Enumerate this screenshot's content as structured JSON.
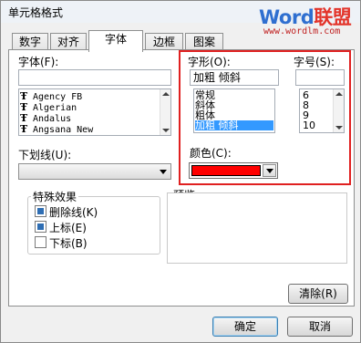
{
  "window": {
    "title": "单元格格式",
    "watermark": {
      "brand_left": "Word",
      "brand_right": "联盟",
      "url": "www.wordlm.com"
    }
  },
  "tabs": [
    {
      "label": "数字",
      "active": false
    },
    {
      "label": "对齐",
      "active": false
    },
    {
      "label": "字体",
      "active": true
    },
    {
      "label": "边框",
      "active": false
    },
    {
      "label": "图案",
      "active": false
    }
  ],
  "font": {
    "label": "字体(F):",
    "value": "",
    "list": [
      "Agency FB",
      "Algerian",
      "Andalus",
      "Angsana New"
    ],
    "icon": "truetype-icon"
  },
  "style": {
    "label": "字形(O):",
    "value": "加粗 倾斜",
    "list": [
      "常规",
      "斜体",
      "粗体",
      "加粗 倾斜"
    ],
    "selected_index": 3
  },
  "size": {
    "label": "字号(S):",
    "value": "",
    "list": [
      "6",
      "8",
      "9",
      "10"
    ]
  },
  "underline": {
    "label": "下划线(U):",
    "value": ""
  },
  "color": {
    "label": "颜色(C):",
    "value_hex": "#ff0000"
  },
  "effects": {
    "title": "特殊效果",
    "items": [
      {
        "label": "删除线(K)",
        "checked": true
      },
      {
        "label": "上标(E)",
        "checked": true
      },
      {
        "label": "下标(B)",
        "checked": false
      }
    ]
  },
  "preview": {
    "title": "预览"
  },
  "buttons": {
    "clear": "清除(R)",
    "ok": "确定",
    "cancel": "取消"
  },
  "colors": {
    "highlight": "#e02020",
    "selection": "#3399ff"
  }
}
